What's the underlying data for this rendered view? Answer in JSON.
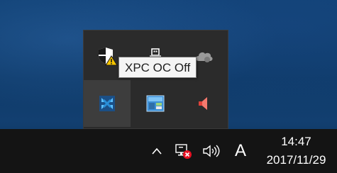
{
  "tooltip": {
    "text": "XPC OC Off"
  },
  "tray_overflow": {
    "icons": [
      {
        "name": "windows-security-warning-icon"
      },
      {
        "name": "usb-device-icon"
      },
      {
        "name": "cloud-sync-icon"
      },
      {
        "name": "xpc-oc-icon"
      },
      {
        "name": "network-settings-app-icon"
      },
      {
        "name": "audio-speaker-app-icon"
      }
    ]
  },
  "taskbar": {
    "ime_indicator": "A",
    "clock": {
      "time": "14:47",
      "date": "2017/11/29"
    }
  },
  "colors": {
    "taskbar_bg": "#141414",
    "flyout_bg": "#2b2b2b",
    "hover_cell_bg": "#3d3d3d",
    "warning_yellow": "#f5c400",
    "error_red": "#e81123",
    "speaker_red": "#e0423a",
    "xpc_blue": "#2a8fd8"
  }
}
